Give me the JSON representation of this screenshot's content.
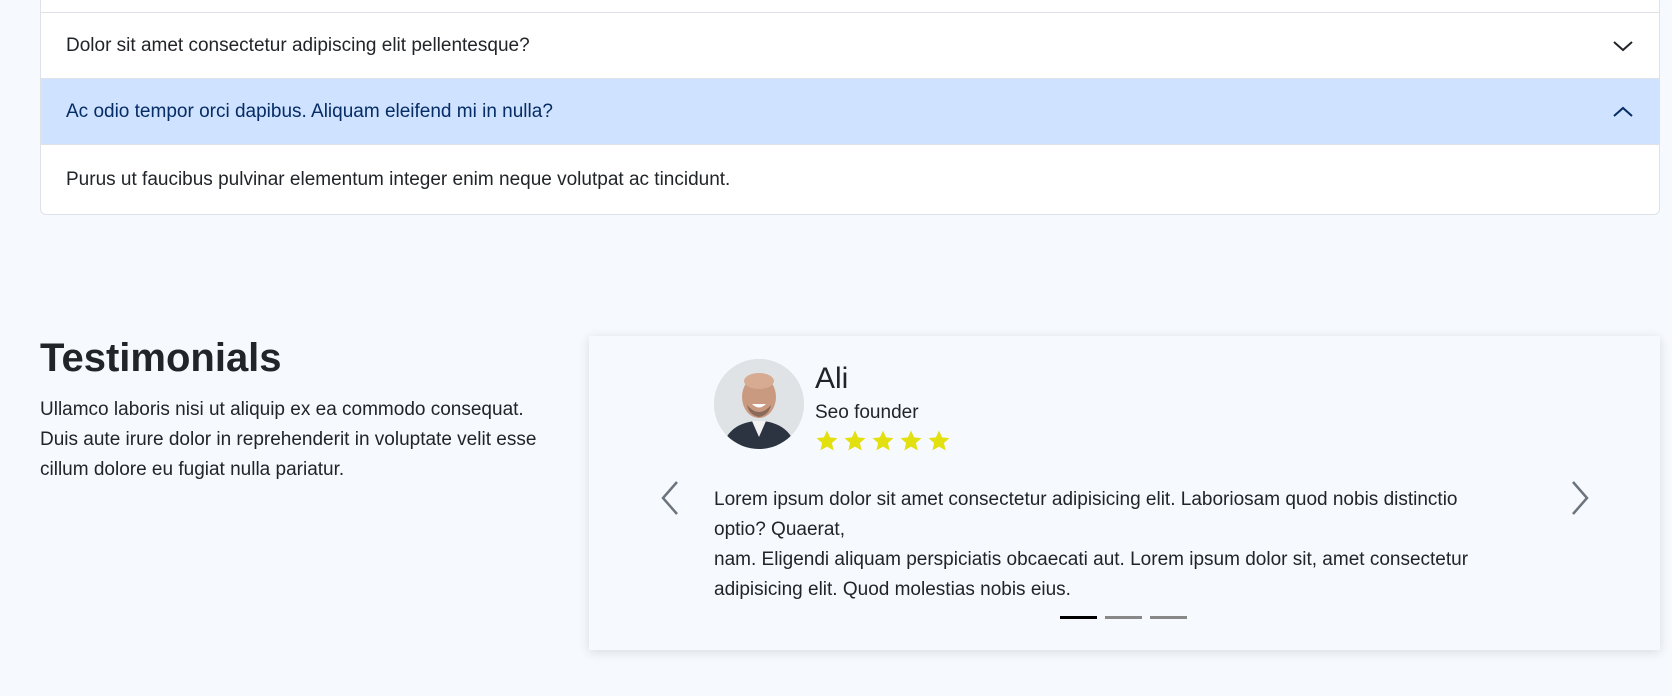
{
  "faq": {
    "items": [
      {
        "question": "Dolor sit amet consectetur adipiscing elit pellentesque?",
        "expanded": false
      },
      {
        "question": "Ac odio tempor orci dapibus. Aliquam eleifend mi in nulla?",
        "expanded": true,
        "answer": "Purus ut faucibus pulvinar elementum integer enim neque volutpat ac tincidunt."
      }
    ]
  },
  "testimonials": {
    "title": "Testimonials",
    "description": "Ullamco laboris nisi ut aliquip ex ea commodo consequat. Duis aute irure dolor in reprehenderit in voluptate velit esse cillum dolore eu fugiat nulla pariatur.",
    "card": {
      "name": "Ali",
      "role": "Seo founder",
      "rating": 5,
      "quote_line1": "Lorem ipsum dolor sit amet consectetur adipisicing elit. Laboriosam quod nobis distinctio optio? Quaerat,",
      "quote_line2": "nam. Eligendi aliquam perspiciatis obcaecati aut. Lorem ipsum dolor sit, amet consectetur adipisicing elit. Quod molestias nobis eius."
    },
    "carousel": {
      "slides": 3,
      "active_index": 0
    }
  },
  "colors": {
    "page_bg": "#f6f9fe",
    "accordion_active_bg": "#cfe2ff",
    "accordion_active_text": "#052c65",
    "star": "#e3e00f",
    "arrow": "#6c757d"
  },
  "icons": {
    "collapsed": "chevron-down-icon",
    "expanded": "chevron-up-icon",
    "prev": "chevron-left-icon",
    "next": "chevron-right-icon",
    "rating": "star-icon"
  }
}
